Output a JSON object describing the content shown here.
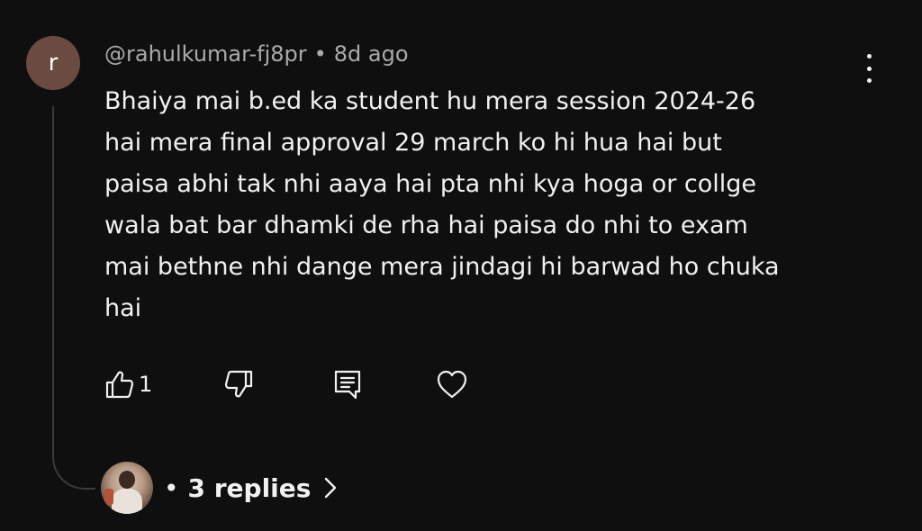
{
  "comment": {
    "avatar_letter": "r",
    "avatar_color": "#6b4a40",
    "author": "@rahulkumar-fj8pr",
    "separator": "•",
    "time": "8d ago",
    "lines": [
      "Bhaiya mai b.ed ka student hu mera session 2024-26",
      "hai mera final approval 29 march ko hi hua hai but",
      "paisa abhi tak nhi aaya hai pta nhi kya hoga or collge",
      "wala bat bar dhamki de rha hai paisa do nhi to exam",
      "mai bethne nhi dange mera jindagi hi barwad ho chuka",
      "hai"
    ],
    "menu_icon": "more-vertical-icon"
  },
  "actions": {
    "like_icon": "thumbs-up-icon",
    "like_count": "1",
    "dislike_icon": "thumbs-down-icon",
    "reply_icon": "reply-icon",
    "heart_icon": "heart-icon"
  },
  "replies": {
    "dot": "•",
    "label": "3 replies",
    "chevron_icon": "chevron-right-icon"
  },
  "colors": {
    "background": "#0f0f0f",
    "text": "#f1f1f1",
    "muted": "#aaaaaa",
    "thread_line": "#3a3a3a"
  }
}
